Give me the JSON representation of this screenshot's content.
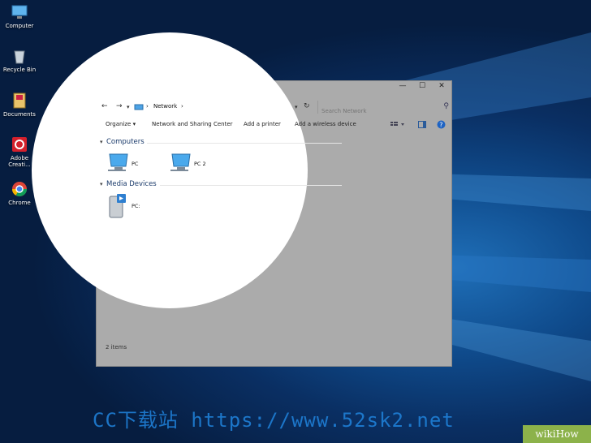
{
  "desktop": {
    "icons": [
      {
        "label": "Computer",
        "icon": "computer-icon"
      },
      {
        "label": "Recycle Bin",
        "icon": "recycle-bin-icon"
      },
      {
        "label": "Documents",
        "icon": "documents-icon"
      },
      {
        "label": "Adobe Creati...",
        "icon": "adobe-creative-cloud-icon"
      },
      {
        "label": "Chrome",
        "icon": "chrome-icon"
      }
    ]
  },
  "window": {
    "controls": {
      "minimize": "—",
      "maximize": "☐",
      "close": "✕"
    },
    "address": {
      "crumb": "Network",
      "sep1": "›",
      "sep2": "›"
    },
    "search": {
      "placeholder": "Search Network"
    },
    "commands": {
      "organize": "Organize ▾",
      "network_sharing": "Network and Sharing Center",
      "add_printer": "Add a printer",
      "add_wireless": "Add a wireless device"
    },
    "groups": {
      "computers": "Computers",
      "media": "Media Devices"
    },
    "items": {
      "pc1": "PC",
      "pc2": "PC 2",
      "media1": "PC:"
    },
    "status": "2 items"
  },
  "watermark": {
    "text": "CC下载站 https://www.52sk2.net",
    "badge": "wikiHow"
  },
  "colors": {
    "window_bg": "#ababab",
    "accent": "#1f7fd6",
    "group_heading": "#1a3a6a"
  }
}
